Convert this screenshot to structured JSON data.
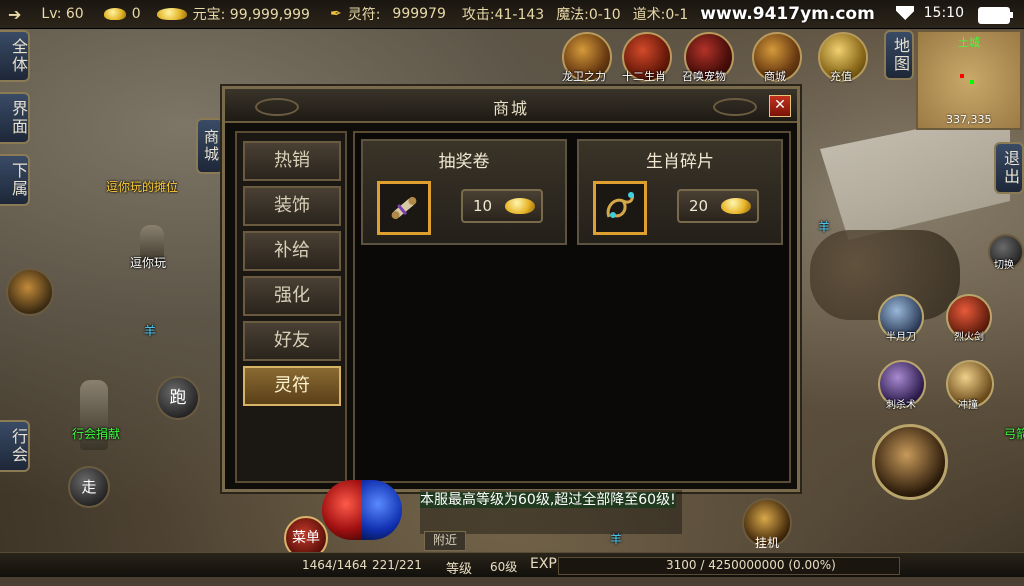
{
  "status": {
    "level": "Lv: 60",
    "gold": "0",
    "yuanbao_label": "元宝: 99,999,999",
    "lingfu_label": "灵符:",
    "lingfu_value": "999979",
    "attack": "攻击:41-143",
    "magic": "魔法:0-10",
    "taoism": "道术:0-1",
    "site": "www.9417ym.com",
    "time": "15:10"
  },
  "left_buttons": [
    "全体",
    "界面",
    "下属",
    "行会"
  ],
  "top_icons": [
    {
      "label": "龙卫之力",
      "icon": "dragon-helmet-icon"
    },
    {
      "label": "十二生肖",
      "icon": "zodiac-icon"
    },
    {
      "label": "召唤宠物",
      "icon": "pet-icon"
    },
    {
      "label": "商城",
      "icon": "treasure-chest-icon"
    },
    {
      "label": "充值",
      "icon": "coins-icon"
    }
  ],
  "map_button": "地图",
  "exit_button": "退出",
  "minimap": {
    "name": "土城",
    "coords": "337,335"
  },
  "shop": {
    "title": "商城",
    "close": "✕",
    "shop_side_label": "商城",
    "tabs": [
      "热销",
      "装饰",
      "补给",
      "强化",
      "好友",
      "灵符"
    ],
    "active_tab": "灵符",
    "items": [
      {
        "name": "抽奖卷",
        "price": "10",
        "icon": "scroll-icon"
      },
      {
        "name": "生肖碎片",
        "price": "20",
        "icon": "dragon-fragment-icon"
      }
    ]
  },
  "npcs": {
    "stall_title": "逗你玩的摊位",
    "player_name": "逗你玩",
    "guild_donate": "行会捐献",
    "sheep1": "羊",
    "sheep2": "羊",
    "sheep3": "羊",
    "archer": "弓箭"
  },
  "skills": [
    {
      "label": "切换"
    },
    {
      "label": "半月刀"
    },
    {
      "label": "烈火剑"
    },
    {
      "label": "刺杀术"
    },
    {
      "label": "冲撞"
    }
  ],
  "controls": {
    "run": "跑",
    "walk": "走",
    "menu": "菜单",
    "hang": "挂机"
  },
  "chat": {
    "message": "本服最高等级为60级,超过全部降至60级!",
    "nearby_tab": "附近"
  },
  "bottom": {
    "hp": "1464/1464",
    "mp": "221/221",
    "level_label": "等级",
    "level_value": "60级",
    "exp_label": "EXP",
    "exp_value": "3100 / 4250000000 (0.00%)"
  }
}
